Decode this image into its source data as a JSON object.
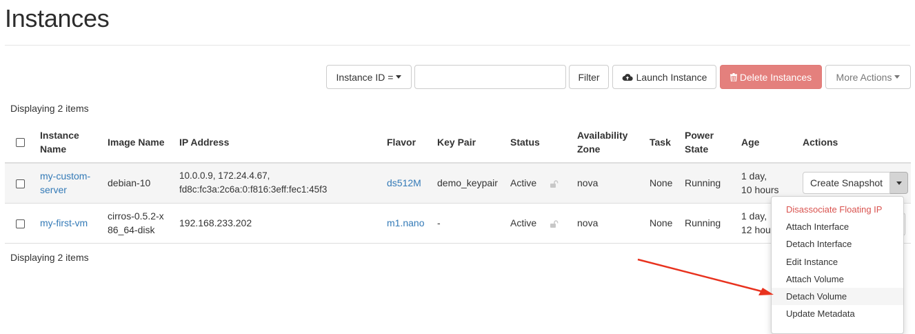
{
  "page": {
    "title": "Instances"
  },
  "toolbar": {
    "filter_field_label": "Instance ID =",
    "filter_input_value": "",
    "filter_button": "Filter",
    "launch_button": "Launch Instance",
    "delete_button": "Delete Instances",
    "more_actions_button": "More Actions"
  },
  "summary": {
    "count_top": "Displaying 2 items",
    "count_bottom": "Displaying 2 items"
  },
  "table": {
    "headers": {
      "instance_name": [
        "Instance",
        "Name"
      ],
      "image_name": "Image Name",
      "ip_address": "IP Address",
      "flavor": "Flavor",
      "key_pair": "Key Pair",
      "status": "Status",
      "availability_zone": [
        "Availability",
        "Zone"
      ],
      "task": "Task",
      "power_state": [
        "Power",
        "State"
      ],
      "age": "Age",
      "actions": "Actions"
    },
    "rows": [
      {
        "name": [
          "my-custom-",
          "server"
        ],
        "image": "debian-10",
        "ip": [
          "10.0.0.9, 172.24.4.67,",
          "fd8c:fc3a:2c6a:0:f816:3eff:fec1:45f3"
        ],
        "flavor": "ds512M",
        "key_pair": "demo_keypair",
        "status": "Active",
        "zone": "nova",
        "task": "None",
        "power": "Running",
        "age": [
          "1 day,",
          "10 hours"
        ],
        "action": "Create Snapshot"
      },
      {
        "name": [
          "my-first-vm"
        ],
        "image": [
          "cirros-0.5.2-x",
          "86_64-disk"
        ],
        "ip": [
          "192.168.233.202"
        ],
        "flavor": "m1.nano",
        "key_pair": "-",
        "status": "Active",
        "zone": "nova",
        "task": "None",
        "power": "Running",
        "age": [
          "1 day,",
          "12 hou"
        ]
      }
    ]
  },
  "dropdown": {
    "items": [
      "Disassociate Floating IP",
      "Attach Interface",
      "Detach Interface",
      "Edit Instance",
      "Attach Volume",
      "Detach Volume",
      "Update Metadata"
    ],
    "highlighted": "Detach Volume"
  },
  "icons": {
    "launch": "cloud-upload-icon",
    "delete": "trash-icon",
    "lock": "unlock-icon",
    "toggle": "caret-down-icon"
  },
  "colors": {
    "link": "#337ab7",
    "danger_button": "#e4807d",
    "danger_text": "#d9534f",
    "annotation_arrow": "#e8321e"
  }
}
